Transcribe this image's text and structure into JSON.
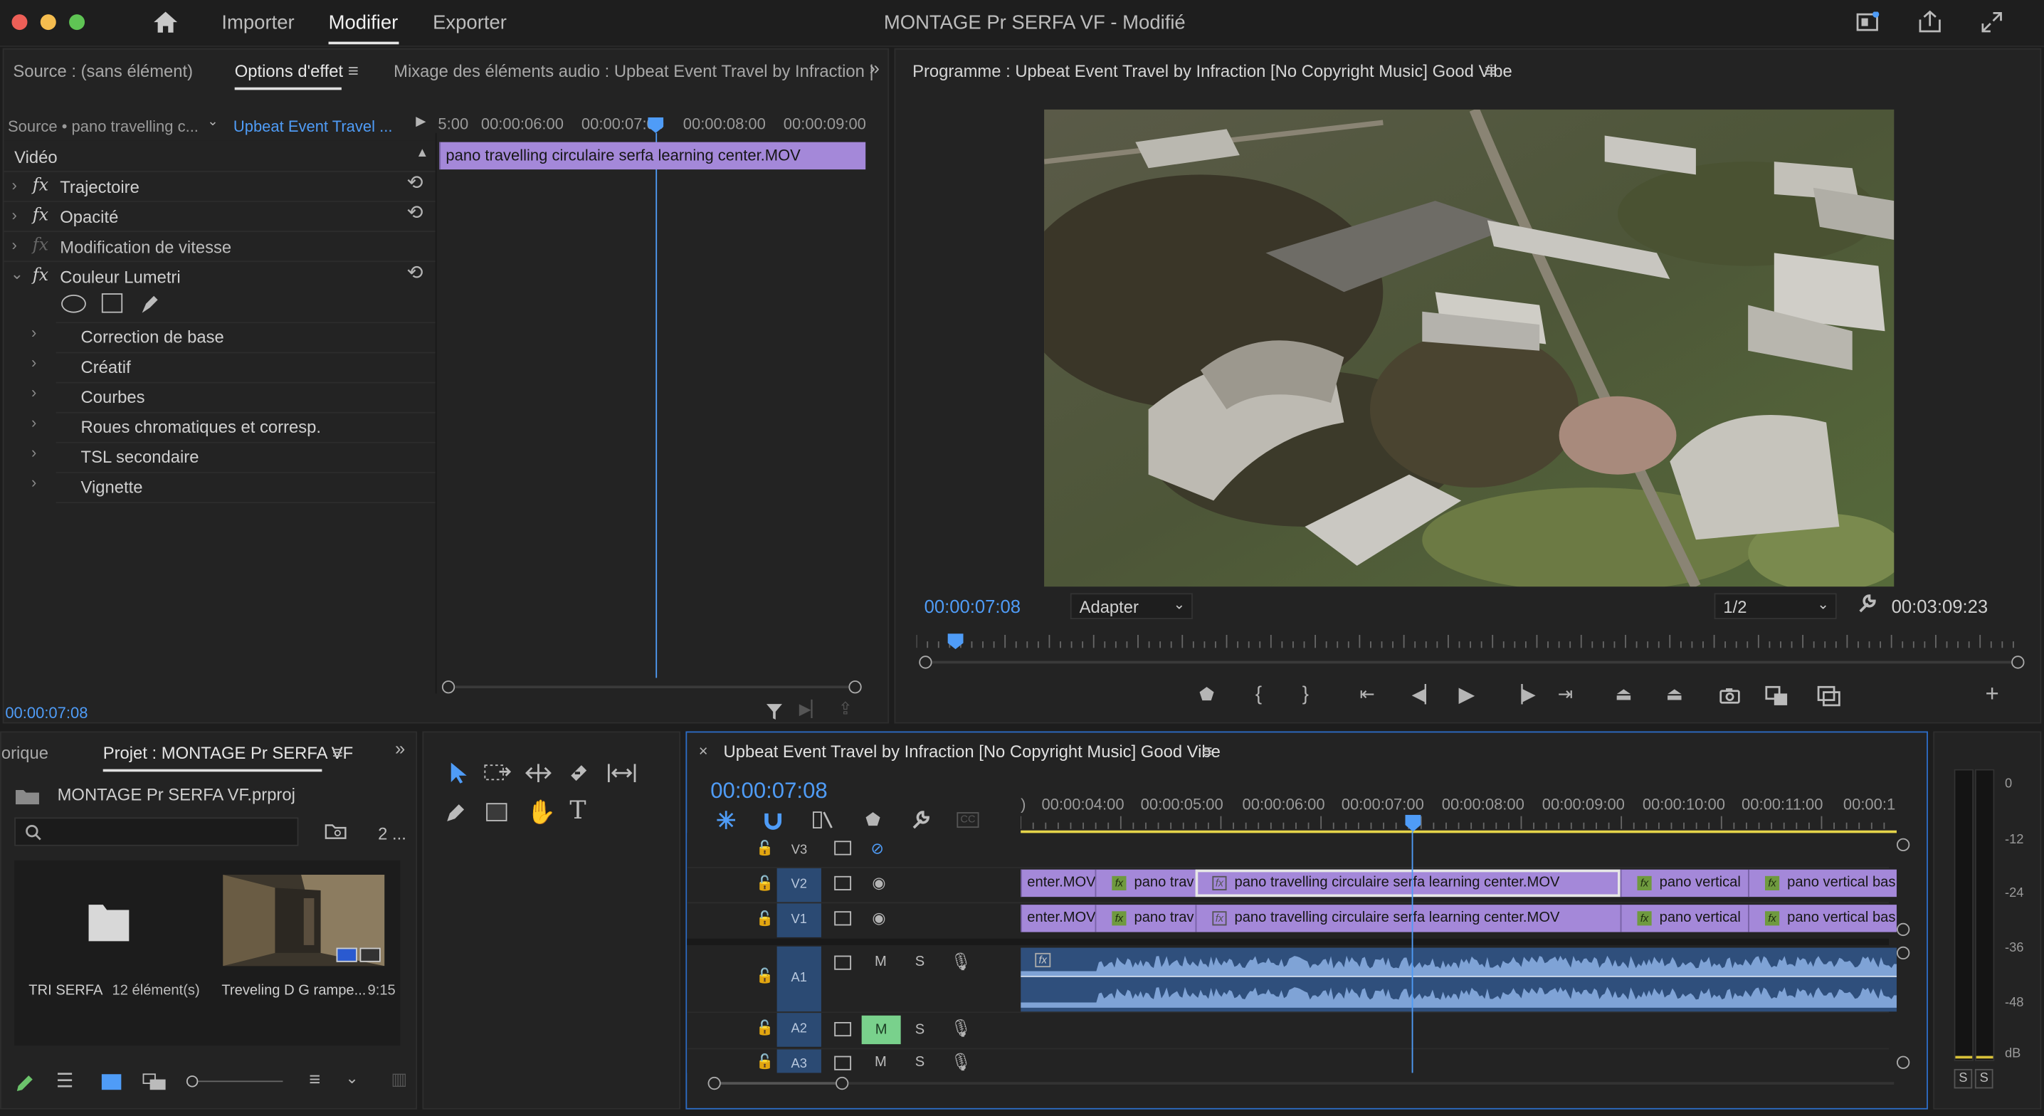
{
  "app": {
    "title": "MONTAGE Pr SERFA VF - Modifié",
    "nav": [
      "Importer",
      "Modifier",
      "Exporter"
    ],
    "active_nav": "Modifier"
  },
  "left_panel": {
    "tabs": [
      "Source : (sans élément)",
      "Options d'effet",
      "Mixage des éléments audio : Upbeat Event Travel by Infraction |"
    ],
    "active_tab": "Options d'effet",
    "source_label": "Source • pano travelling c...",
    "sequence_label": "Upbeat Event Travel ...",
    "ruler": [
      "5:00",
      "00:00:06:00",
      "00:00:07:00",
      "00:00:08:00",
      "00:00:09:00"
    ],
    "clip_name": "pano travelling circulaire serfa learning center.MOV",
    "video_header": "Vidéo",
    "effects": [
      {
        "label": "Trajectoire",
        "active": true
      },
      {
        "label": "Opacité",
        "active": true
      },
      {
        "label": "Modification de vitesse",
        "active": false
      },
      {
        "label": "Couleur Lumetri",
        "active": true
      }
    ],
    "lumetri_sections": [
      "Correction de base",
      "Créatif",
      "Courbes",
      "Roues chromatiques et corresp.",
      "TSL secondaire",
      "Vignette"
    ],
    "timecode": "00:00:07:08"
  },
  "program_monitor": {
    "title": "Programme : Upbeat Event Travel by Infraction [No Copyright Music]  Good Vibe",
    "timecode": "00:00:07:08",
    "fit": "Adapter",
    "resolution": "1/2",
    "duration": "00:03:09:23"
  },
  "project_panel": {
    "tabs": [
      "orique",
      "Projet : MONTAGE Pr SERFA VF"
    ],
    "active_tab": "Projet : MONTAGE Pr SERFA VF",
    "file": "MONTAGE Pr SERFA VF.prproj",
    "count": "2 ...",
    "items": [
      {
        "name": "TRI SERFA",
        "meta": "12 élément(s)",
        "type": "bin"
      },
      {
        "name": "Treveling D G rampe...",
        "meta": "9:15",
        "type": "clip"
      }
    ]
  },
  "timeline": {
    "title": "Upbeat Event Travel by Infraction [No Copyright Music]  Good Vibe",
    "timecode": "00:00:07:08",
    "ruler": [
      ")",
      "00:00:04:00",
      "00:00:05:00",
      "00:00:06:00",
      "00:00:07:00",
      "00:00:08:00",
      "00:00:09:00",
      "00:00:10:00",
      "00:00:11:00",
      "00:00:1"
    ],
    "tracks": [
      "V3",
      "V2",
      "V1",
      "A1",
      "A2",
      "A3"
    ],
    "mute_label": "M",
    "solo_label": "S",
    "clips_v2": [
      "enter.MOV",
      "pano trav",
      "pano travelling circulaire serfa learning center.MOV",
      "pano vertical",
      "pano vertical bas"
    ],
    "clips_v1": [
      "enter.MOV",
      "pano trav",
      "pano travelling circulaire serfa learning center.MOV",
      "pano vertical",
      "pano vertical bas"
    ]
  },
  "meter": {
    "scale": [
      "0",
      "-12",
      "-24",
      "-36",
      "-48",
      "dB"
    ],
    "solo": [
      "S",
      "S"
    ]
  },
  "colors": {
    "accent": "#4f9cf7",
    "clip": "#a488d9",
    "audio": "#7fa3d6",
    "mute_active": "#79d18c"
  }
}
